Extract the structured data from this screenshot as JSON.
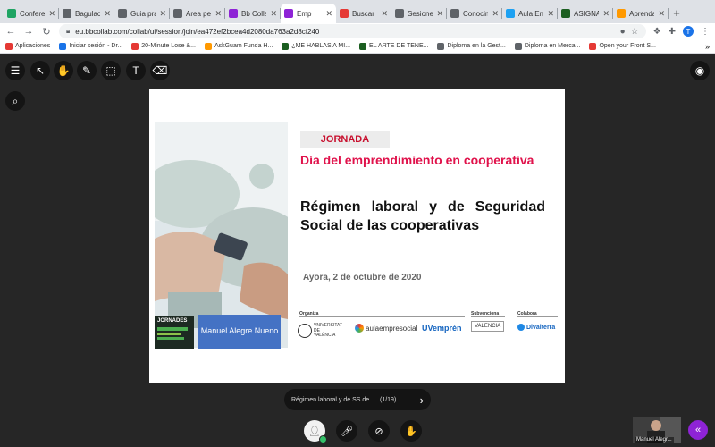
{
  "browser": {
    "tabs": [
      {
        "title": "Confere",
        "icon": "green-icon",
        "color": "#1fa463",
        "active": false
      },
      {
        "title": "Bagulaci",
        "icon": "globe-icon",
        "color": "#5f6368",
        "active": false
      },
      {
        "title": "Guia pra",
        "icon": "grad-icon",
        "color": "#5f6368",
        "active": false
      },
      {
        "title": "Area pe",
        "icon": "a-icon",
        "color": "#5f6368",
        "active": false
      },
      {
        "title": "Bb Colla",
        "icon": "bb-icon",
        "color": "#8e23d6",
        "active": false
      },
      {
        "title": "Emp",
        "icon": "bb-icon",
        "color": "#8e23d6",
        "active": true
      },
      {
        "title": "Buscar",
        "icon": "youtube-icon",
        "color": "#e53935",
        "active": false
      },
      {
        "title": "Sesiones",
        "icon": "globe-icon",
        "color": "#5f6368",
        "active": false
      },
      {
        "title": "Conocim",
        "icon": "pen-icon",
        "color": "#5f6368",
        "active": false
      },
      {
        "title": "Aula Em",
        "icon": "twitter-icon",
        "color": "#1da1f2",
        "active": false
      },
      {
        "title": "ASIGNA",
        "icon": "u-icon",
        "color": "#1b5e20",
        "active": false
      },
      {
        "title": "Aprenda",
        "icon": "amazon-icon",
        "color": "#ff9900",
        "active": false
      }
    ],
    "new_tab": "+",
    "url": "eu.bbcollab.com/collab/ui/session/join/ea472ef2bcea4d2080da763a2d8cf240",
    "profile_initial": "T",
    "bookmarks": [
      {
        "label": "Aplicaciones",
        "color": "#e53935"
      },
      {
        "label": "Iniciar sesión - Dr...",
        "color": "#1a73e8"
      },
      {
        "label": "20-Minute Lose &...",
        "color": "#e53935"
      },
      {
        "label": "AskGuam Funda H...",
        "color": "#ff9900"
      },
      {
        "label": "¿ME HABLAS A MI...",
        "color": "#1b5e20"
      },
      {
        "label": "EL ARTE DE TENE...",
        "color": "#1b5e20"
      },
      {
        "label": "Diploma en la Gest...",
        "color": "#5f6368"
      },
      {
        "label": "Diploma en Merca...",
        "color": "#5f6368"
      },
      {
        "label": "Open your Front S...",
        "color": "#e53935"
      }
    ],
    "more_bookmarks": "»"
  },
  "slide": {
    "badge": "JORNADA",
    "subtitle": "Día del emprendimiento en cooperativa",
    "title": "Régimen laboral y de Seguridad Social de las cooperativas",
    "date": "Ayora, 2 de octubre de 2020",
    "speaker": "Manuel Alegre Nueno",
    "jornades_logo": "JORNADES",
    "sponsors": {
      "organiza_label": "Organiza",
      "subvenciona_label": "Subvenciona",
      "colabora_label": "Colabora",
      "univ": "VNIVERSITAT DE VALÈNCIA",
      "aula": "aulaempresocial",
      "uvempren": "UVemprén",
      "valencia": "VALENCIA",
      "divalterra": "Divalterra"
    }
  },
  "pager": {
    "label": "Régimen laboral y de SS de...",
    "count": "(1/19)"
  },
  "camera": {
    "name": "Manuel Alegr..."
  }
}
